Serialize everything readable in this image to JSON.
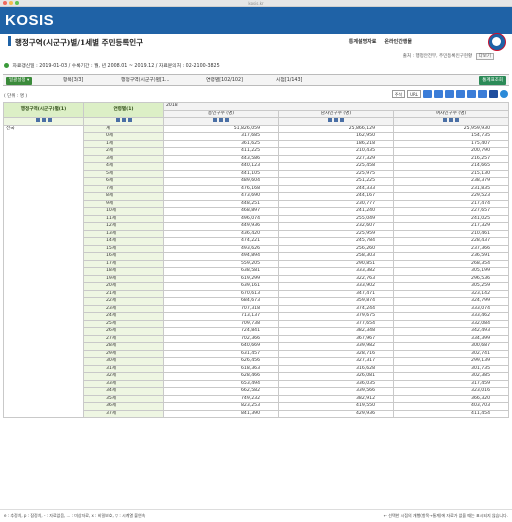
{
  "browser": {
    "url": "kosis.kr",
    "dot_colors": [
      "#ee6a5f",
      "#f5bd4f",
      "#61c454"
    ]
  },
  "header": {
    "logo": "KOSIS",
    "bg_color": "#1f62a6"
  },
  "title": {
    "text": "행정구역(시군구)별/1세별 주민등록인구",
    "links": [
      "통계설명자료",
      "온라인간행물"
    ]
  },
  "source": {
    "text": "출처 : 행정안전부, 주민등록인구현황",
    "button": "다보기"
  },
  "meta": {
    "text": "자료갱신일 : 2019-01-03 / 수록기간 : 월, 년 2008.01 ~ 2019.12 / 자료문의처 : 02-2100-3825"
  },
  "toolbar": {
    "settings": "일괄설정 ▾",
    "items": [
      "항목[3/3]",
      "행정구역(시군구)별[1...",
      "연령별[102/102]",
      "시점[1/143]"
    ],
    "stats_button": "통계표조회"
  },
  "unit_label": "( 단위 : 명 )",
  "right_tools": {
    "select1": "주석",
    "select2": "URL",
    "icon_colors": [
      "#3b7dd8",
      "#3b7dd8",
      "#3b7dd8",
      "#3b7dd8",
      "#3b7dd8",
      "#3b7dd8",
      "#1f4e9e",
      "#2b8ad8"
    ]
  },
  "table": {
    "col_region": "행정구역(시군구)별(1)",
    "col_age": "연령별(1)",
    "year": "2018",
    "col_headers": [
      "총인구수 (명)",
      "남자인구수 (명)",
      "여자인구수 (명)"
    ],
    "region": "전국",
    "rows": [
      [
        "계",
        "51,826,059",
        "25,866,129",
        "25,959,930"
      ],
      [
        "0세",
        "317,685",
        "162,950",
        "154,735"
      ],
      [
        "1세",
        "361,625",
        "186,218",
        "175,407"
      ],
      [
        "2세",
        "411,225",
        "210,435",
        "200,790"
      ],
      [
        "3세",
        "443,586",
        "227,329",
        "216,257"
      ],
      [
        "4세",
        "440,123",
        "225,458",
        "214,665"
      ],
      [
        "5세",
        "441,105",
        "225,975",
        "215,130"
      ],
      [
        "6세",
        "489,604",
        "251,225",
        "238,379"
      ],
      [
        "7세",
        "476,168",
        "244,333",
        "231,835"
      ],
      [
        "8세",
        "473,690",
        "244,167",
        "229,523"
      ],
      [
        "9세",
        "448,251",
        "230,777",
        "217,474"
      ],
      [
        "10세",
        "468,897",
        "241,240",
        "227,657"
      ],
      [
        "11세",
        "496,074",
        "255,049",
        "241,025"
      ],
      [
        "12세",
        "449,936",
        "232,607",
        "217,329"
      ],
      [
        "13세",
        "436,420",
        "225,959",
        "210,461"
      ],
      [
        "14세",
        "474,221",
        "245,784",
        "228,437"
      ],
      [
        "15세",
        "493,626",
        "256,260",
        "237,366"
      ],
      [
        "16세",
        "494,894",
        "258,303",
        "236,591"
      ],
      [
        "17세",
        "559,205",
        "290,851",
        "268,354"
      ],
      [
        "18세",
        "638,581",
        "333,382",
        "305,199"
      ],
      [
        "19세",
        "619,299",
        "322,763",
        "296,536"
      ],
      [
        "20세",
        "639,161",
        "333,902",
        "305,259"
      ],
      [
        "21세",
        "670,613",
        "347,471",
        "323,142"
      ],
      [
        "22세",
        "684,673",
        "359,874",
        "324,799"
      ],
      [
        "23세",
        "707,318",
        "374,244",
        "333,074"
      ],
      [
        "24세",
        "713,137",
        "379,675",
        "333,462"
      ],
      [
        "25세",
        "709,738",
        "377,654",
        "332,084"
      ],
      [
        "26세",
        "724,841",
        "382,348",
        "342,493"
      ],
      [
        "27세",
        "702,366",
        "367,967",
        "334,399"
      ],
      [
        "28세",
        "640,669",
        "339,982",
        "300,687"
      ],
      [
        "29세",
        "631,457",
        "328,716",
        "302,741"
      ],
      [
        "30세",
        "626,456",
        "327,317",
        "299,139"
      ],
      [
        "31세",
        "618,363",
        "316,628",
        "301,735"
      ],
      [
        "32세",
        "628,466",
        "326,081",
        "302,385"
      ],
      [
        "33세",
        "653,494",
        "336,035",
        "317,459"
      ],
      [
        "34세",
        "662,582",
        "339,566",
        "323,016"
      ],
      [
        "35세",
        "749,232",
        "382,912",
        "366,320"
      ],
      [
        "36세",
        "823,253",
        "419,550",
        "403,703"
      ],
      [
        "37세",
        "841,390",
        "429,936",
        "411,454"
      ]
    ]
  },
  "footer": {
    "left": "e : 추정치, p : 잠정치, - : 자료없음, ... : 미상자료, x : 비밀보호, ▽ : 시계열 불연속",
    "right": "← 선택한 시점의 개행(항목→통계)에 자료가 없을 때는 표시되지 않습니다."
  }
}
